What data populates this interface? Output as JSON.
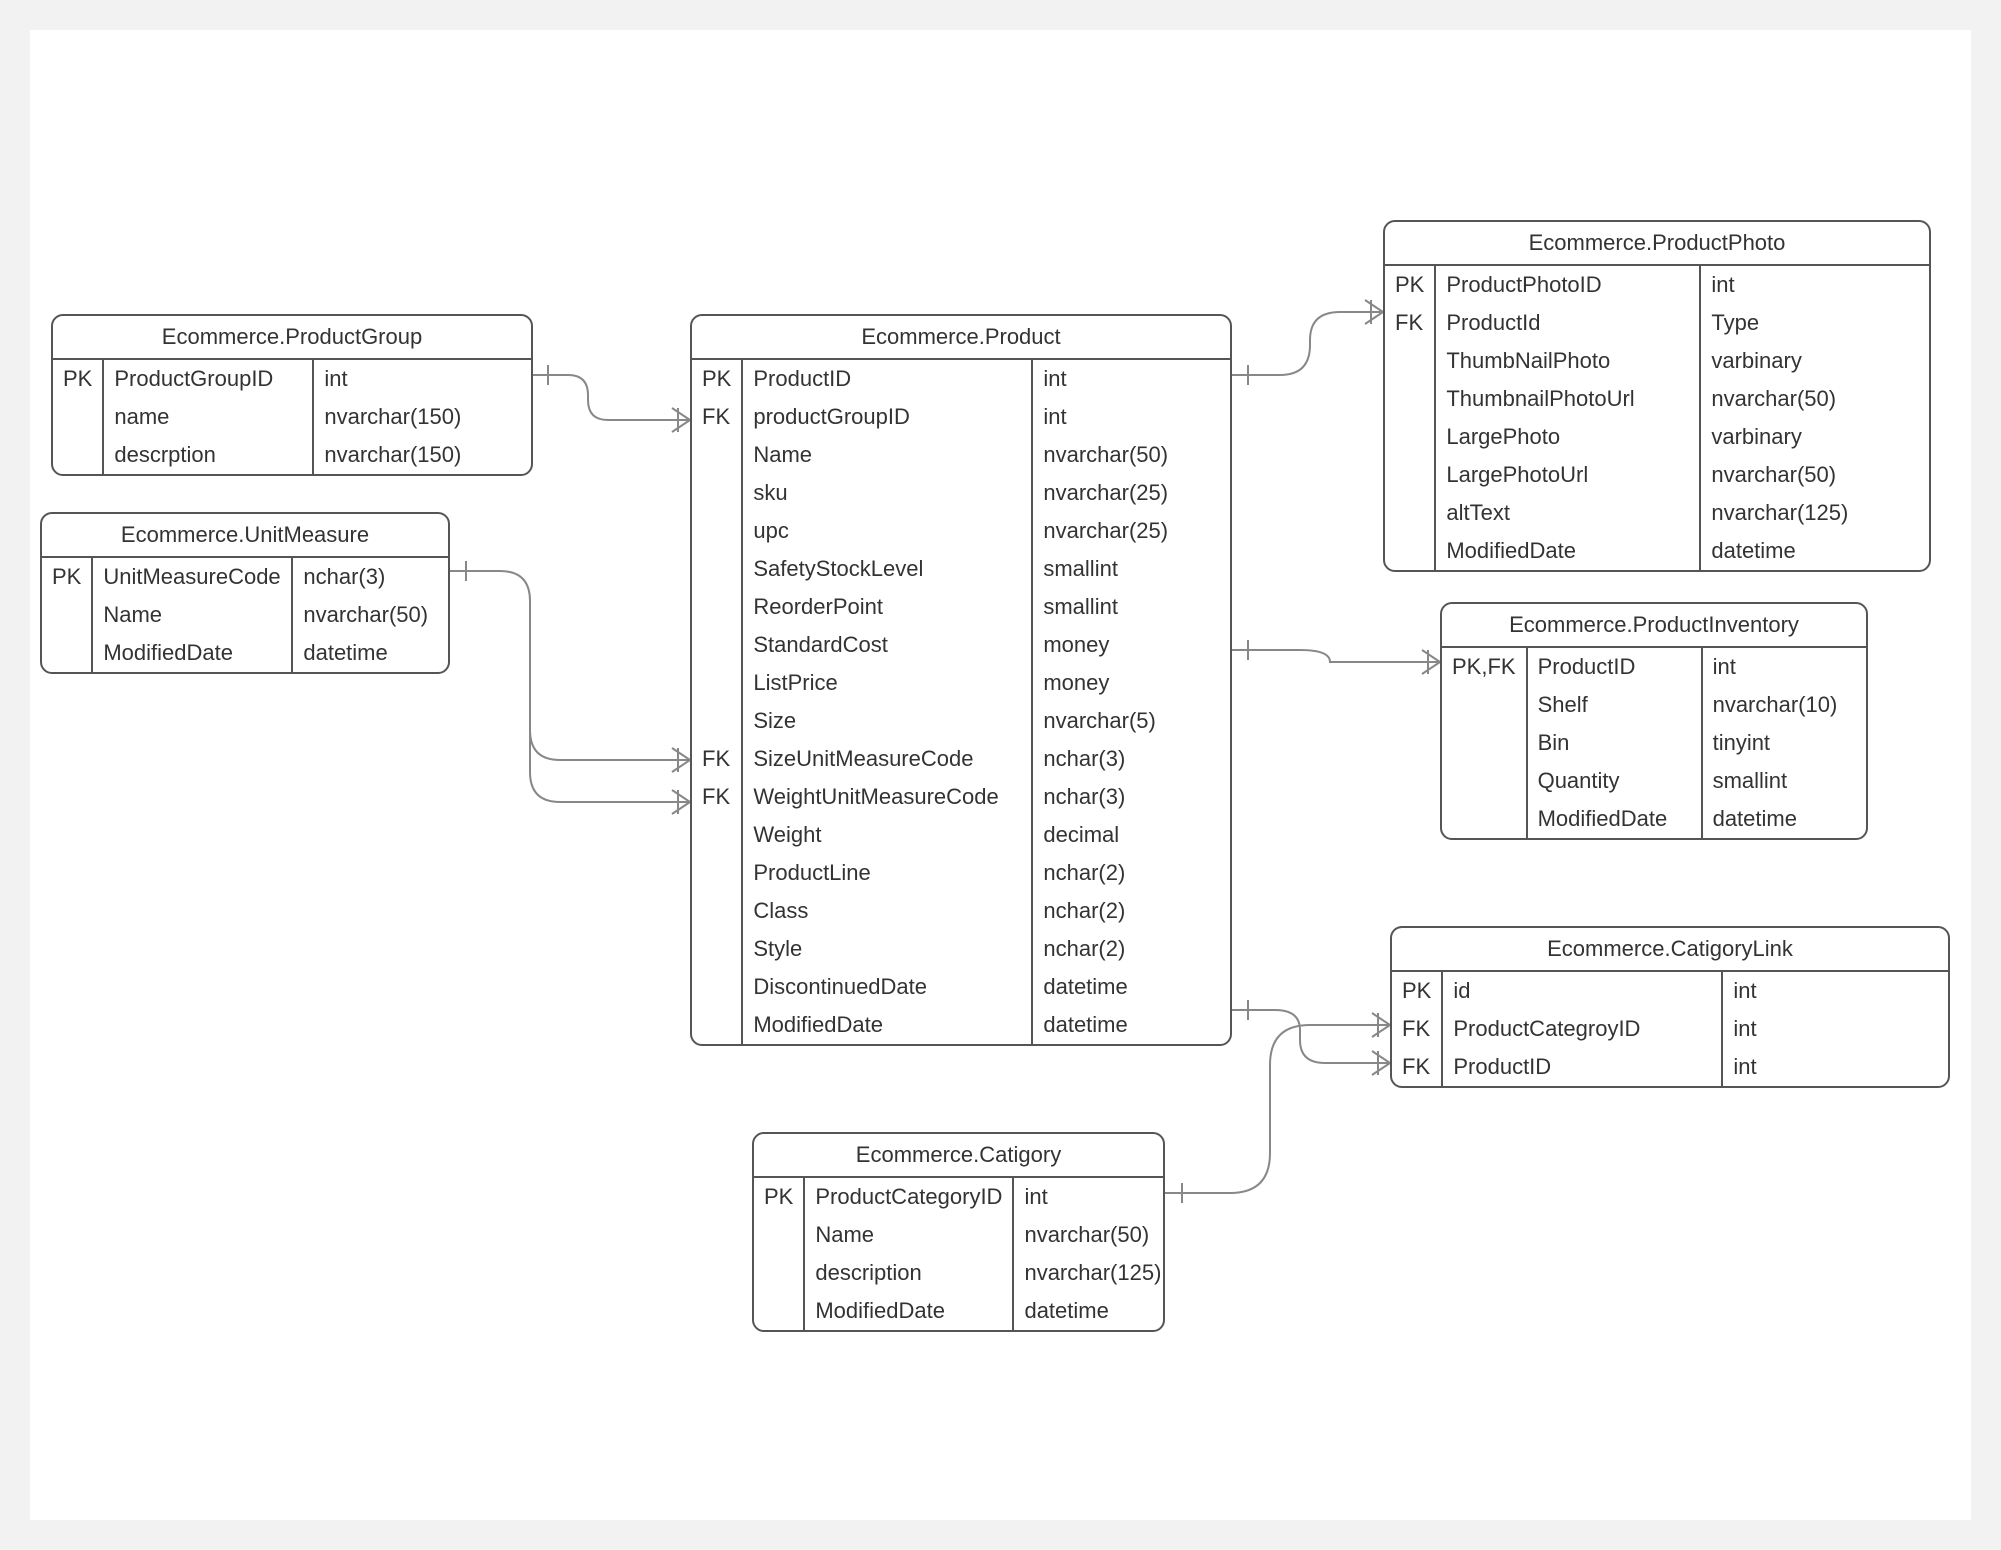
{
  "entities": {
    "productGroup": {
      "title": "Ecommerce.ProductGroup",
      "rows": [
        {
          "key": "PK",
          "name": "ProductGroupID",
          "type": "int"
        },
        {
          "key": "",
          "name": "name",
          "type": "nvarchar(150)"
        },
        {
          "key": "",
          "name": "descrption",
          "type": "nvarchar(150)"
        }
      ]
    },
    "unitMeasure": {
      "title": "Ecommerce.UnitMeasure",
      "rows": [
        {
          "key": "PK",
          "name": "UnitMeasureCode",
          "type": "nchar(3)"
        },
        {
          "key": "",
          "name": "Name",
          "type": "nvarchar(50)"
        },
        {
          "key": "",
          "name": "ModifiedDate",
          "type": "datetime"
        }
      ]
    },
    "product": {
      "title": "Ecommerce.Product",
      "rows": [
        {
          "key": "PK",
          "name": "ProductID",
          "type": "int"
        },
        {
          "key": "FK",
          "name": "productGroupID",
          "type": "int"
        },
        {
          "key": "",
          "name": "Name",
          "type": "nvarchar(50)"
        },
        {
          "key": "",
          "name": "sku",
          "type": "nvarchar(25)"
        },
        {
          "key": "",
          "name": "upc",
          "type": "nvarchar(25)"
        },
        {
          "key": "",
          "name": "SafetyStockLevel",
          "type": "smallint"
        },
        {
          "key": "",
          "name": "ReorderPoint",
          "type": "smallint"
        },
        {
          "key": "",
          "name": "StandardCost",
          "type": "money"
        },
        {
          "key": "",
          "name": "ListPrice",
          "type": "money"
        },
        {
          "key": "",
          "name": "Size",
          "type": "nvarchar(5)"
        },
        {
          "key": "FK",
          "name": "SizeUnitMeasureCode",
          "type": "nchar(3)"
        },
        {
          "key": "FK",
          "name": "WeightUnitMeasureCode",
          "type": "nchar(3)"
        },
        {
          "key": "",
          "name": "Weight",
          "type": "decimal"
        },
        {
          "key": "",
          "name": "ProductLine",
          "type": "nchar(2)"
        },
        {
          "key": "",
          "name": "Class",
          "type": "nchar(2)"
        },
        {
          "key": "",
          "name": "Style",
          "type": "nchar(2)"
        },
        {
          "key": "",
          "name": "DiscontinuedDate",
          "type": "datetime"
        },
        {
          "key": "",
          "name": "ModifiedDate",
          "type": "datetime"
        }
      ]
    },
    "productPhoto": {
      "title": "Ecommerce.ProductPhoto",
      "rows": [
        {
          "key": "PK",
          "name": "ProductPhotoID",
          "type": "int"
        },
        {
          "key": "FK",
          "name": "ProductId",
          "type": "Type"
        },
        {
          "key": "",
          "name": "ThumbNailPhoto",
          "type": "varbinary"
        },
        {
          "key": "",
          "name": "ThumbnailPhotoUrl",
          "type": "nvarchar(50)"
        },
        {
          "key": "",
          "name": "LargePhoto",
          "type": "varbinary"
        },
        {
          "key": "",
          "name": "LargePhotoUrl",
          "type": "nvarchar(50)"
        },
        {
          "key": "",
          "name": "altText",
          "type": "nvarchar(125)"
        },
        {
          "key": "",
          "name": "ModifiedDate",
          "type": "datetime"
        }
      ]
    },
    "productInventory": {
      "title": "Ecommerce.ProductInventory",
      "rows": [
        {
          "key": "PK,FK",
          "name": "ProductID",
          "type": "int"
        },
        {
          "key": "",
          "name": "Shelf",
          "type": "nvarchar(10)"
        },
        {
          "key": "",
          "name": "Bin",
          "type": "tinyint"
        },
        {
          "key": "",
          "name": "Quantity",
          "type": "smallint"
        },
        {
          "key": "",
          "name": "ModifiedDate",
          "type": "datetime"
        }
      ]
    },
    "catigoryLink": {
      "title": "Ecommerce.CatigoryLink",
      "rows": [
        {
          "key": "PK",
          "name": "id",
          "type": "int"
        },
        {
          "key": "FK",
          "name": "ProductCategroyID",
          "type": "int"
        },
        {
          "key": "FK",
          "name": "ProductID",
          "type": "int"
        }
      ]
    },
    "catigory": {
      "title": "Ecommerce.Catigory",
      "rows": [
        {
          "key": "PK",
          "name": "ProductCategoryID",
          "type": "int"
        },
        {
          "key": "",
          "name": "Name",
          "type": "nvarchar(50)"
        },
        {
          "key": "",
          "name": "description",
          "type": "nvarchar(125)"
        },
        {
          "key": "",
          "name": "ModifiedDate",
          "type": "datetime"
        }
      ]
    }
  }
}
